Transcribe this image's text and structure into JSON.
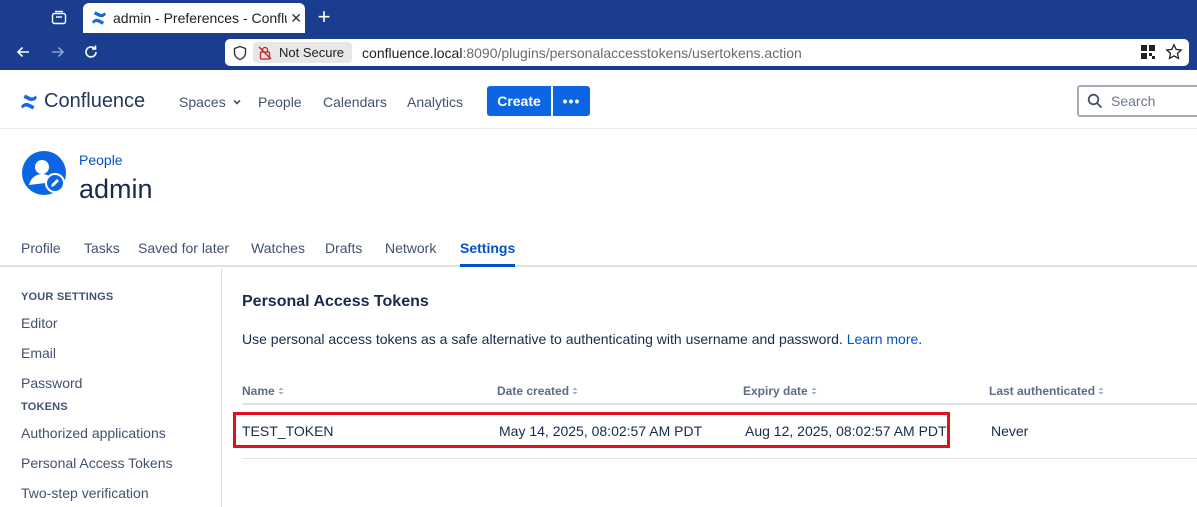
{
  "browser": {
    "tab_title": "admin - Preferences - Confluence",
    "tab_close": "✕",
    "new_tab": "+",
    "not_secure_label": "Not Secure",
    "url_host": "confluence.local",
    "url_rest": ":8090/plugins/personalaccesstokens/usertokens.action"
  },
  "header": {
    "logo_text": "Confluence",
    "nav": {
      "spaces": "Spaces",
      "people": "People",
      "calendars": "Calendars",
      "analytics": "Analytics"
    },
    "create_label": "Create",
    "more_label": "•••",
    "search_placeholder": "Search"
  },
  "profile": {
    "breadcrumb": "People",
    "title": "admin",
    "tabs": [
      "Profile",
      "Tasks",
      "Saved for later",
      "Watches",
      "Drafts",
      "Network",
      "Settings"
    ],
    "active_tab": "Settings"
  },
  "sidebar": {
    "your_settings_heading": "YOUR SETTINGS",
    "your_settings_items": [
      "Editor",
      "Email",
      "Password"
    ],
    "tokens_heading": "TOKENS",
    "tokens_items": [
      "Authorized applications",
      "Personal Access Tokens",
      "Two-step verification"
    ]
  },
  "main": {
    "title": "Personal Access Tokens",
    "description": "Use personal access tokens as a safe alternative to authenticating with username and password.",
    "learn_more": "Learn more",
    "period": ".",
    "table": {
      "headers": [
        "Name",
        "Date created",
        "Expiry date",
        "Last authenticated"
      ],
      "rows": [
        [
          "TEST_TOKEN",
          "May 14, 2025, 08:02:57 AM PDT",
          "Aug 12, 2025, 08:02:57 AM PDT",
          "Never"
        ]
      ]
    }
  },
  "colors": {
    "browser_chrome": "#1a3d8f",
    "accent": "#0c66e4",
    "link": "#0052cc",
    "highlight": "#e0101f"
  }
}
